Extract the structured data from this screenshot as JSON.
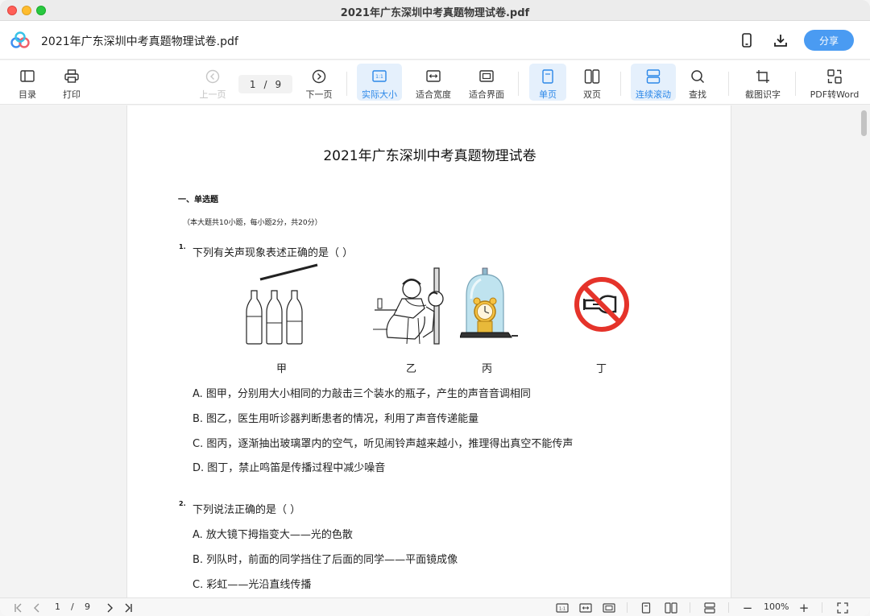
{
  "window": {
    "title": "2021年广东深圳中考真题物理试卷.pdf"
  },
  "header": {
    "doc_name": "2021年广东深圳中考真题物理试卷.pdf",
    "share_label": "分享",
    "accent": "#4a9bf2",
    "icons": [
      "mobile-icon",
      "download-icon"
    ]
  },
  "toolbar": {
    "toc": "目录",
    "print": "打印",
    "prev": "上一页",
    "page_current": "1",
    "page_sep": "/",
    "page_total": "9",
    "next": "下一页",
    "actual_size": "实际大小",
    "fit_width": "适合宽度",
    "fit_page": "适合界面",
    "single_page": "单页",
    "double_page": "双页",
    "continuous": "连续滚动",
    "find": "查找",
    "screenshot_ocr": "截图识字",
    "pdf_to_word": "PDF转Word"
  },
  "document": {
    "title": "2021年广东深圳中考真题物理试卷",
    "section": "一、单选题",
    "section_note": "（本大题共10小题，每小题2分，共20分）",
    "questions": [
      {
        "num": "1.",
        "text": "下列有关声现象表述正确的是（    ）",
        "figure_captions": [
          "甲",
          "乙",
          "丙",
          "丁"
        ],
        "options": [
          "A. 图甲，分别用大小相同的力敲击三个装水的瓶子，产生的声音音调相同",
          "B. 图乙，医生用听诊器判断患者的情况，利用了声音传递能量",
          "C. 图丙，逐渐抽出玻璃罩内的空气，听见闹铃声越来越小，推理得出真空不能传声",
          "D. 图丁，禁止鸣笛是传播过程中减少噪音"
        ]
      },
      {
        "num": "2.",
        "text": "下列说法正确的是（    ）",
        "options": [
          "A. 放大镜下拇指变大——光的色散",
          "B. 列队时，前面的同学挡住了后面的同学——平面镜成像",
          "C. 彩虹——光沿直线传播"
        ]
      }
    ]
  },
  "statusbar": {
    "page_current": "1",
    "page_sep": "/",
    "page_total": "9",
    "zoom": "100%",
    "zoom_in": "+",
    "zoom_out": "−"
  }
}
